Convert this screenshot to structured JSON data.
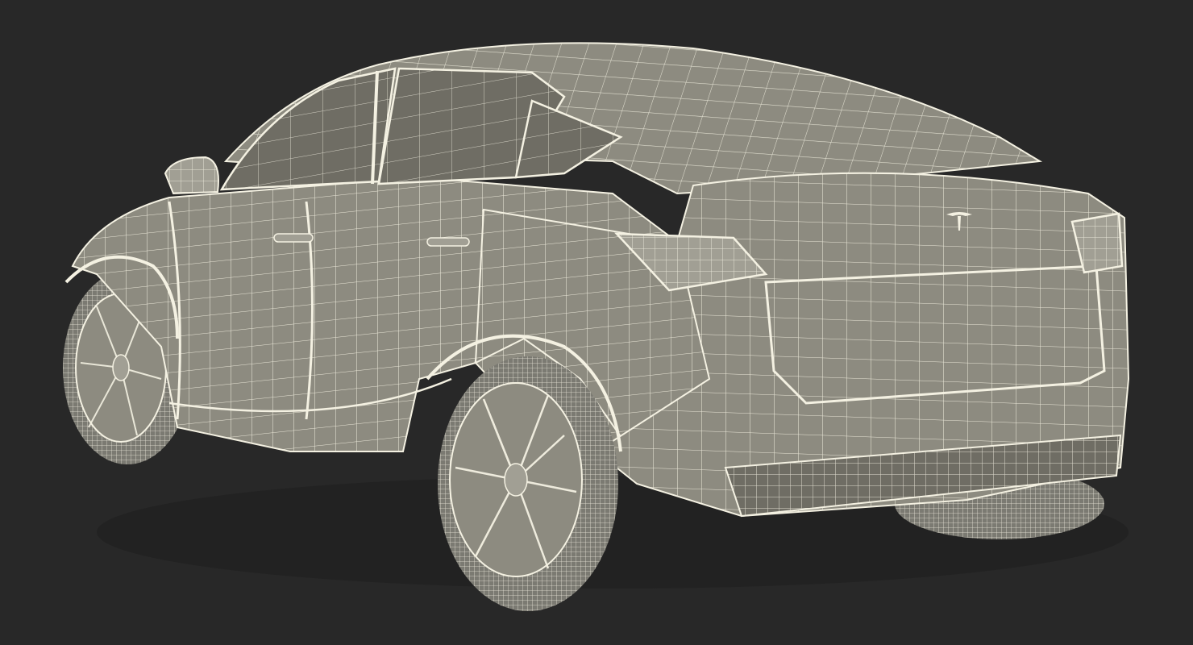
{
  "scene": {
    "subject": "car-wireframe-render",
    "colors": {
      "background": "#282828",
      "surface": "#8d8b80",
      "surface_dark": "#6f6d64",
      "surface_light": "#a19f94",
      "wire": "#f4f1e2",
      "tire": "#7b7a72",
      "shadow": "#1e1e1e"
    }
  }
}
